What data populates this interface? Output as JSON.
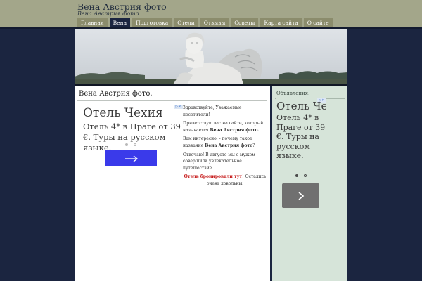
{
  "header": {
    "site_title": "Вена Австрия фото",
    "site_description": "Вена Австрия фото"
  },
  "nav": {
    "items": [
      {
        "label": "Главная",
        "active": false
      },
      {
        "label": "Вена",
        "active": true
      },
      {
        "label": "Подготовка",
        "active": false
      },
      {
        "label": "Отели",
        "active": false
      },
      {
        "label": "Отзывы",
        "active": false
      },
      {
        "label": "Советы",
        "active": false
      },
      {
        "label": "Карта сайта",
        "active": false
      },
      {
        "label": "О сайте",
        "active": false
      }
    ]
  },
  "content": {
    "page_title": "Вена Австрия фото.",
    "ad": {
      "badge": "▷✕",
      "title": "Отель Чехия",
      "text": "Отель 4* в Праге от 39 €. Туры на русском языке.",
      "button_icon": "arrow-right-icon",
      "button_color": "#3a3aea"
    },
    "intro": {
      "greeting": "Здравствуйте, Уважаемые посетители!",
      "welcome_pre": "Приветствую вас на сайте, который называется ",
      "welcome_bold": "Вена Австрия фото.",
      "question_pre": "Вам интересно, - почему такое название ",
      "question_bold": "Вена Австрия фото",
      "question_post": "?",
      "answer": "Отвечаю! В августе мы с мужем совершили увлекательное путешествие.",
      "hotel_link": "Отель бронировали тут!",
      "hotel_post": " Остались очень довольны."
    }
  },
  "sidebar": {
    "title": "Объявления.",
    "ad": {
      "badge": "▷✕",
      "title": "Отель Чехия",
      "text": "Отель 4* в Праге от 39 €. Туры на русском языке.",
      "button_icon": "chevron-right-icon",
      "button_color": "#707070"
    }
  },
  "colors": {
    "page_background": "#1b2540",
    "header_band": "#a3a68a",
    "nav_tab": "#8b8c6c",
    "nav_tab_active": "#1b2540",
    "sidebar_background": "#d6e4d9",
    "link_red": "#c61a1a"
  }
}
